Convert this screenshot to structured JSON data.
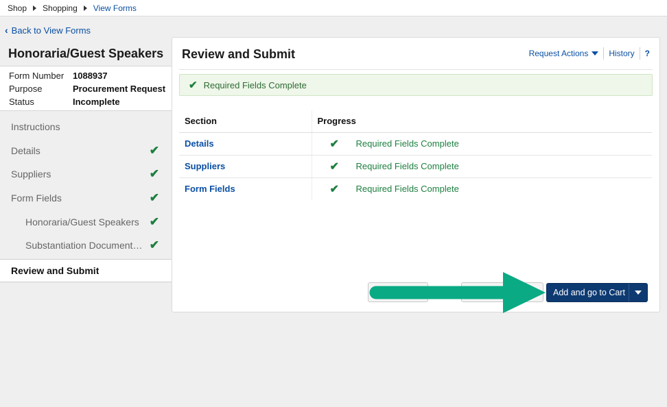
{
  "breadcrumb": {
    "items": [
      {
        "label": "Shop"
      },
      {
        "label": "Shopping"
      },
      {
        "label": "View Forms"
      }
    ]
  },
  "back_link": {
    "label": "Back to View Forms"
  },
  "form": {
    "title": "Honoraria/Guest Speakers",
    "fields": [
      {
        "label": "Form Number",
        "value": "1088937"
      },
      {
        "label": "Purpose",
        "value": "Procurement Request"
      },
      {
        "label": "Status",
        "value": "Incomplete"
      }
    ]
  },
  "sidebar": {
    "items": [
      {
        "label": "Instructions",
        "complete": false
      },
      {
        "label": "Details",
        "complete": true
      },
      {
        "label": "Suppliers",
        "complete": true
      },
      {
        "label": "Form Fields",
        "complete": true
      },
      {
        "label": "Honoraria/Guest Speakers",
        "complete": true
      },
      {
        "label": "Substantiation Documentation",
        "complete": true
      },
      {
        "label": "Review and Submit",
        "complete": false
      }
    ]
  },
  "panel": {
    "title": "Review and Submit",
    "actions": {
      "request_actions": "Request Actions",
      "history": "History",
      "help": "?"
    },
    "alert": "Required Fields Complete",
    "table": {
      "headers": [
        "Section",
        "Progress"
      ],
      "rows": [
        {
          "section": "Details",
          "progress": "Required Fields Complete"
        },
        {
          "section": "Suppliers",
          "progress": "Required Fields Complete"
        },
        {
          "section": "Form Fields",
          "progress": "Required Fields Complete"
        }
      ]
    },
    "primary_button": "Add and go to Cart"
  },
  "colors": {
    "accent": "#0a4fa3",
    "primary_button": "#0e3a72",
    "success": "#1d7f3f",
    "annotation_arrow": "#0aaa84"
  },
  "icons": {
    "check": "check-icon",
    "caret": "caret-down-icon",
    "crumb_separator": "triangle-right-icon"
  }
}
